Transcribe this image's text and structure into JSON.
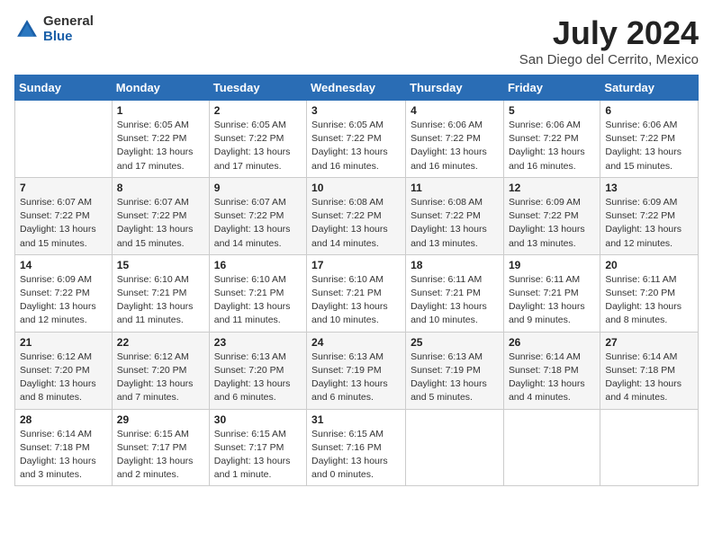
{
  "logo": {
    "general": "General",
    "blue": "Blue"
  },
  "header": {
    "month_year": "July 2024",
    "location": "San Diego del Cerrito, Mexico"
  },
  "days_of_week": [
    "Sunday",
    "Monday",
    "Tuesday",
    "Wednesday",
    "Thursday",
    "Friday",
    "Saturday"
  ],
  "weeks": [
    [
      {
        "day": "",
        "info": ""
      },
      {
        "day": "1",
        "info": "Sunrise: 6:05 AM\nSunset: 7:22 PM\nDaylight: 13 hours\nand 17 minutes."
      },
      {
        "day": "2",
        "info": "Sunrise: 6:05 AM\nSunset: 7:22 PM\nDaylight: 13 hours\nand 17 minutes."
      },
      {
        "day": "3",
        "info": "Sunrise: 6:05 AM\nSunset: 7:22 PM\nDaylight: 13 hours\nand 16 minutes."
      },
      {
        "day": "4",
        "info": "Sunrise: 6:06 AM\nSunset: 7:22 PM\nDaylight: 13 hours\nand 16 minutes."
      },
      {
        "day": "5",
        "info": "Sunrise: 6:06 AM\nSunset: 7:22 PM\nDaylight: 13 hours\nand 16 minutes."
      },
      {
        "day": "6",
        "info": "Sunrise: 6:06 AM\nSunset: 7:22 PM\nDaylight: 13 hours\nand 15 minutes."
      }
    ],
    [
      {
        "day": "7",
        "info": "Sunrise: 6:07 AM\nSunset: 7:22 PM\nDaylight: 13 hours\nand 15 minutes."
      },
      {
        "day": "8",
        "info": "Sunrise: 6:07 AM\nSunset: 7:22 PM\nDaylight: 13 hours\nand 15 minutes."
      },
      {
        "day": "9",
        "info": "Sunrise: 6:07 AM\nSunset: 7:22 PM\nDaylight: 13 hours\nand 14 minutes."
      },
      {
        "day": "10",
        "info": "Sunrise: 6:08 AM\nSunset: 7:22 PM\nDaylight: 13 hours\nand 14 minutes."
      },
      {
        "day": "11",
        "info": "Sunrise: 6:08 AM\nSunset: 7:22 PM\nDaylight: 13 hours\nand 13 minutes."
      },
      {
        "day": "12",
        "info": "Sunrise: 6:09 AM\nSunset: 7:22 PM\nDaylight: 13 hours\nand 13 minutes."
      },
      {
        "day": "13",
        "info": "Sunrise: 6:09 AM\nSunset: 7:22 PM\nDaylight: 13 hours\nand 12 minutes."
      }
    ],
    [
      {
        "day": "14",
        "info": "Sunrise: 6:09 AM\nSunset: 7:22 PM\nDaylight: 13 hours\nand 12 minutes."
      },
      {
        "day": "15",
        "info": "Sunrise: 6:10 AM\nSunset: 7:21 PM\nDaylight: 13 hours\nand 11 minutes."
      },
      {
        "day": "16",
        "info": "Sunrise: 6:10 AM\nSunset: 7:21 PM\nDaylight: 13 hours\nand 11 minutes."
      },
      {
        "day": "17",
        "info": "Sunrise: 6:10 AM\nSunset: 7:21 PM\nDaylight: 13 hours\nand 10 minutes."
      },
      {
        "day": "18",
        "info": "Sunrise: 6:11 AM\nSunset: 7:21 PM\nDaylight: 13 hours\nand 10 minutes."
      },
      {
        "day": "19",
        "info": "Sunrise: 6:11 AM\nSunset: 7:21 PM\nDaylight: 13 hours\nand 9 minutes."
      },
      {
        "day": "20",
        "info": "Sunrise: 6:11 AM\nSunset: 7:20 PM\nDaylight: 13 hours\nand 8 minutes."
      }
    ],
    [
      {
        "day": "21",
        "info": "Sunrise: 6:12 AM\nSunset: 7:20 PM\nDaylight: 13 hours\nand 8 minutes."
      },
      {
        "day": "22",
        "info": "Sunrise: 6:12 AM\nSunset: 7:20 PM\nDaylight: 13 hours\nand 7 minutes."
      },
      {
        "day": "23",
        "info": "Sunrise: 6:13 AM\nSunset: 7:20 PM\nDaylight: 13 hours\nand 6 minutes."
      },
      {
        "day": "24",
        "info": "Sunrise: 6:13 AM\nSunset: 7:19 PM\nDaylight: 13 hours\nand 6 minutes."
      },
      {
        "day": "25",
        "info": "Sunrise: 6:13 AM\nSunset: 7:19 PM\nDaylight: 13 hours\nand 5 minutes."
      },
      {
        "day": "26",
        "info": "Sunrise: 6:14 AM\nSunset: 7:18 PM\nDaylight: 13 hours\nand 4 minutes."
      },
      {
        "day": "27",
        "info": "Sunrise: 6:14 AM\nSunset: 7:18 PM\nDaylight: 13 hours\nand 4 minutes."
      }
    ],
    [
      {
        "day": "28",
        "info": "Sunrise: 6:14 AM\nSunset: 7:18 PM\nDaylight: 13 hours\nand 3 minutes."
      },
      {
        "day": "29",
        "info": "Sunrise: 6:15 AM\nSunset: 7:17 PM\nDaylight: 13 hours\nand 2 minutes."
      },
      {
        "day": "30",
        "info": "Sunrise: 6:15 AM\nSunset: 7:17 PM\nDaylight: 13 hours\nand 1 minute."
      },
      {
        "day": "31",
        "info": "Sunrise: 6:15 AM\nSunset: 7:16 PM\nDaylight: 13 hours\nand 0 minutes."
      },
      {
        "day": "",
        "info": ""
      },
      {
        "day": "",
        "info": ""
      },
      {
        "day": "",
        "info": ""
      }
    ]
  ]
}
